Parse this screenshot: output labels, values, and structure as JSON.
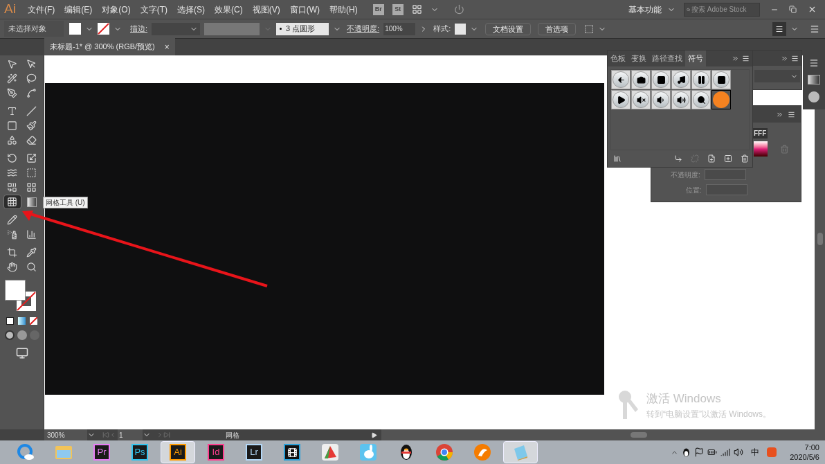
{
  "app_logo": "Ai",
  "menu": [
    "文件(F)",
    "编辑(E)",
    "对象(O)",
    "文字(T)",
    "选择(S)",
    "效果(C)",
    "视图(V)",
    "窗口(W)",
    "帮助(H)"
  ],
  "bridge_buttons": [
    "Br",
    "St"
  ],
  "workspace": "基本功能",
  "search": {
    "placeholder": "搜索 Adobe Stock"
  },
  "control_bar": {
    "selection": "未选择对象",
    "stroke_label": "描边:",
    "brush": "3 点圆形",
    "opacity_label": "不透明度:",
    "opacity": "100%",
    "style_label": "样式:",
    "buttons": [
      "文档设置",
      "首选项"
    ]
  },
  "document_tab": {
    "title": "未标题-1* @ 300% (RGB/预览)",
    "close": "×"
  },
  "tools": [
    [
      {
        "kind": "select",
        "selected": false
      },
      {
        "kind": "direct-select",
        "selected": false
      }
    ],
    [
      {
        "kind": "wand",
        "selected": false
      },
      {
        "kind": "lasso",
        "selected": false
      }
    ],
    [
      {
        "kind": "pen",
        "selected": false
      },
      {
        "kind": "curvature",
        "selected": false
      }
    ],
    [
      {
        "kind": "type",
        "selected": false
      },
      {
        "kind": "line",
        "selected": false
      }
    ],
    [
      {
        "kind": "rectangle",
        "selected": false
      },
      {
        "kind": "brush",
        "selected": false
      }
    ],
    [
      {
        "kind": "shaper",
        "selected": false
      },
      {
        "kind": "eraser",
        "selected": false
      }
    ],
    [
      {
        "kind": "rotate",
        "selected": false
      },
      {
        "kind": "scale",
        "selected": false
      }
    ],
    [
      {
        "kind": "width",
        "selected": false
      },
      {
        "kind": "free-transform",
        "selected": false
      }
    ],
    [
      {
        "kind": "shape-builder",
        "selected": false
      },
      {
        "kind": "perspective",
        "selected": false
      }
    ],
    [
      {
        "kind": "mesh",
        "selected": true
      },
      {
        "kind": "gradient",
        "selected": false
      }
    ],
    [
      {
        "kind": "pencil",
        "selected": false
      }
    ],
    [
      {
        "kind": "sprayer",
        "selected": false
      },
      {
        "kind": "graph",
        "selected": false
      }
    ],
    [
      {
        "kind": "artboard",
        "selected": false
      },
      {
        "kind": "eyedropper",
        "selected": false
      }
    ],
    [
      {
        "kind": "hand",
        "selected": false
      },
      {
        "kind": "zoom",
        "selected": false
      }
    ]
  ],
  "tooltip": "网格工具 (U)",
  "symbols_panel": {
    "tabs": [
      {
        "label": "色板",
        "selected": false
      },
      {
        "label": "变换",
        "selected": false
      },
      {
        "label": "路径查找",
        "selected": false
      },
      {
        "label": "符号",
        "selected": true
      }
    ],
    "symbols": [
      {
        "kind": "back",
        "selected": false
      },
      {
        "kind": "camera",
        "selected": false
      },
      {
        "kind": "film",
        "selected": false
      },
      {
        "kind": "music",
        "selected": false
      },
      {
        "kind": "pause",
        "selected": false
      },
      {
        "kind": "stop",
        "selected": false
      },
      {
        "kind": "play",
        "selected": false
      },
      {
        "kind": "mute",
        "selected": false
      },
      {
        "kind": "volume-low",
        "selected": false
      },
      {
        "kind": "volume-high",
        "selected": false
      },
      {
        "kind": "search",
        "selected": false
      },
      {
        "kind": "dot",
        "selected": true
      }
    ]
  },
  "color_panel": {
    "hex": "FFF",
    "opacity_label": "不透明度:",
    "position_label": "位置:"
  },
  "activation": {
    "title": "激活 Windows",
    "message": "转到“电脑设置”以激活 Windows。"
  },
  "status_bar": {
    "zoom": "300%",
    "artboard": "1",
    "tool": "网格"
  },
  "taskbar": {
    "apps": [
      {
        "kind": "browser",
        "selected": false
      },
      {
        "kind": "folder",
        "selected": false
      },
      {
        "kind": "adobe",
        "label": "Pr",
        "color": "#e77cf5",
        "selected": false
      },
      {
        "kind": "adobe",
        "label": "Ps",
        "color": "#31c5f0",
        "selected": false
      },
      {
        "kind": "adobe",
        "label": "Ai",
        "color": "#ff9a00",
        "selected": true
      },
      {
        "kind": "adobe",
        "label": "Id",
        "color": "#ff3e8e",
        "selected": false
      },
      {
        "kind": "adobe",
        "label": "Lr",
        "color": "#b3d8f8",
        "selected": false
      },
      {
        "kind": "video",
        "selected": false
      },
      {
        "kind": "chart",
        "selected": false
      },
      {
        "kind": "bunny",
        "selected": false
      },
      {
        "kind": "penguin",
        "selected": false
      },
      {
        "kind": "chrome",
        "selected": false
      },
      {
        "kind": "fox",
        "selected": false
      },
      {
        "kind": "notepad",
        "selected": true
      }
    ],
    "ime": "中",
    "time": "7:00",
    "date": "2020/5/6"
  }
}
